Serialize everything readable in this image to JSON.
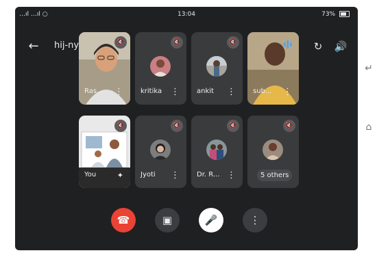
{
  "status_bar": {
    "left": "…ıl …ıl ○",
    "time": "13:04",
    "battery": "73%"
  },
  "header": {
    "back_icon": "arrow-left-icon",
    "meeting_code": "hij-nyvb-sdj",
    "chevron": "▸",
    "icons": [
      "audio-bars-icon",
      "switch-camera-icon",
      "speaker-icon"
    ]
  },
  "participants": [
    {
      "name": "Ras...",
      "muted": true
    },
    {
      "name": "kritika",
      "muted": true
    },
    {
      "name": "ankit",
      "muted": true
    },
    {
      "name": "sub...",
      "muted": false
    },
    {
      "name": "You",
      "muted": true
    },
    {
      "name": "Jyoti",
      "muted": true
    },
    {
      "name": "Dr. R...",
      "muted": true
    },
    {
      "name": "5 others",
      "muted": true
    }
  ],
  "controls": [
    {
      "name": "end-call",
      "icon": "phone-hangup-icon",
      "color": "#ea4335"
    },
    {
      "name": "camera",
      "icon": "camera-icon",
      "color": "#3c3d40"
    },
    {
      "name": "microphone",
      "icon": "mic-off-icon",
      "color": "#ffffff"
    },
    {
      "name": "more",
      "icon": "more-vert-icon",
      "color": "#3c3d40"
    }
  ],
  "system_nav": [
    "back-nav-icon",
    "home-nav-icon"
  ],
  "colors": {
    "background": "#1f2022",
    "tile": "#3a3b3d",
    "end_call": "#ea4335",
    "audio_accent": "#4aa3f5"
  }
}
